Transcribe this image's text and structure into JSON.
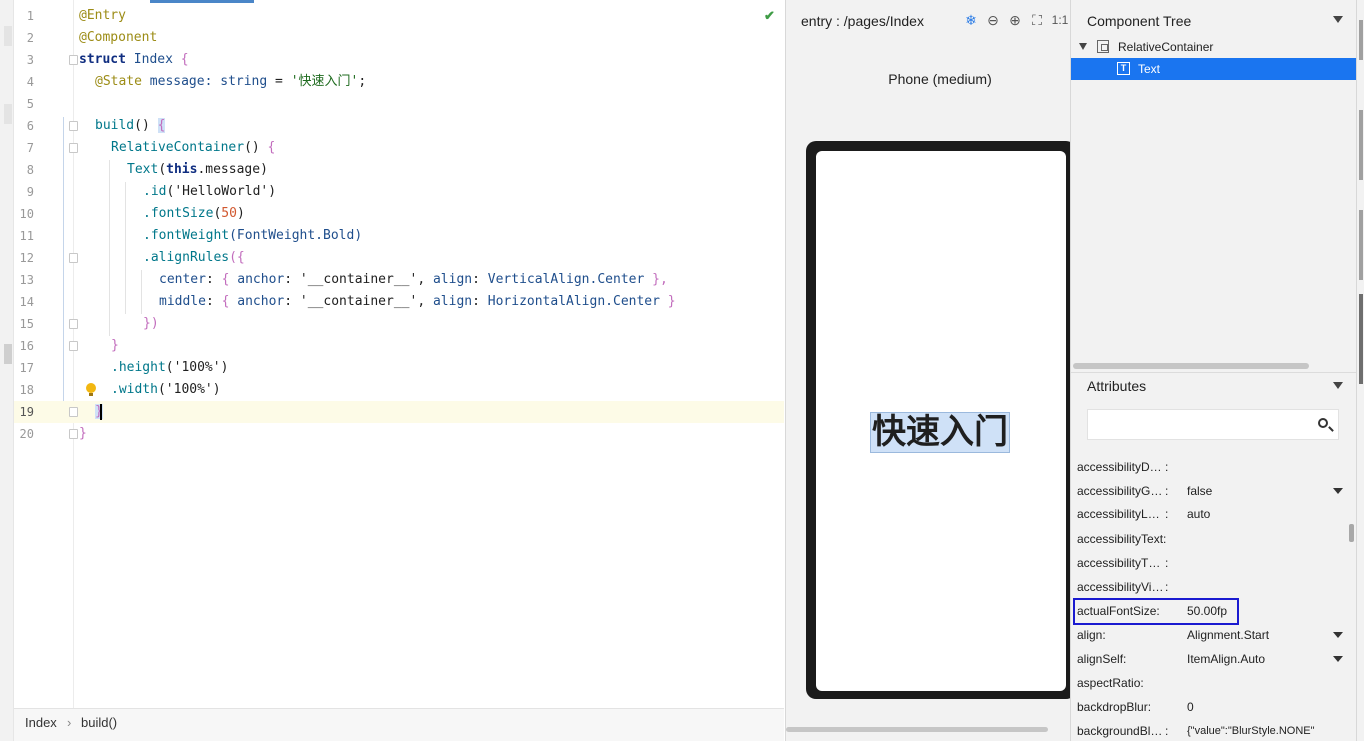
{
  "editor": {
    "lines": [
      {
        "n": "1"
      },
      {
        "n": "2"
      },
      {
        "n": "3"
      },
      {
        "n": "4"
      },
      {
        "n": "5"
      },
      {
        "n": "6"
      },
      {
        "n": "7"
      },
      {
        "n": "8"
      },
      {
        "n": "9"
      },
      {
        "n": "10"
      },
      {
        "n": "11"
      },
      {
        "n": "12"
      },
      {
        "n": "13"
      },
      {
        "n": "14"
      },
      {
        "n": "15"
      },
      {
        "n": "16"
      },
      {
        "n": "17"
      },
      {
        "n": "18"
      },
      {
        "n": "19"
      },
      {
        "n": "20"
      }
    ],
    "code": {
      "l1": "@Entry",
      "l2": "@Component",
      "l3_kw": "struct",
      "l3_name": " Index ",
      "l3_brace": "{",
      "l4_ann": "@State",
      "l4_a": " message: ",
      "l4_type": "string",
      "l4_eq": " = ",
      "l4_str": "'快速入门'",
      "l4_end": ";",
      "l6_fn": "build",
      "l6_paren": "() ",
      "l6_brace": "{",
      "l7_fn": "RelativeContainer",
      "l7_paren": "() ",
      "l7_brace": "{",
      "l8_fn": "Text",
      "l8_open": "(",
      "l8_this": "this",
      "l8_rest": ".message)",
      "l9_fn": ".id",
      "l9_open": "(",
      "l9_str": "'HelloWorld'",
      "l9_close": ")",
      "l10_fn": ".fontSize",
      "l10_open": "(",
      "l10_num": "50",
      "l10_close": ")",
      "l11_fn": ".fontWeight",
      "l11_arg": "(FontWeight.Bold)",
      "l12_fn": ".alignRules",
      "l12_open": "({",
      "l13_key": "center",
      "l13_a": ": ",
      "l13_b1": "{",
      "l13_k2": " anchor",
      "l13_c": ": ",
      "l13_str": "'__container__'",
      "l13_comma": ", ",
      "l13_k3": "align",
      "l13_d": ": ",
      "l13_val": "VerticalAlign.Center",
      "l13_b2": " },",
      "l14_key": "middle",
      "l14_a": ": ",
      "l14_b1": "{",
      "l14_k2": " anchor",
      "l14_c": ": ",
      "l14_str": "'__container__'",
      "l14_comma": ", ",
      "l14_k3": "align",
      "l14_d": ": ",
      "l14_val": "HorizontalAlign.Center",
      "l14_b2": " }",
      "l15": "})",
      "l16": "}",
      "l17_fn": ".height",
      "l17_open": "(",
      "l17_str": "'100%'",
      "l17_close": ")",
      "l18_fn": ".width",
      "l18_open": "(",
      "l18_str": "'100%'",
      "l18_close": ")",
      "l19": "}",
      "l20": "}"
    },
    "status_check": "✔"
  },
  "breadcrumb": {
    "items": [
      "Index",
      "build()"
    ],
    "separator": "›"
  },
  "preview": {
    "path": "entry : /pages/Index",
    "tools": {
      "freeze": "❄",
      "zoom_out": "⊖",
      "zoom_in": "⊕",
      "fit": "⛶",
      "ratio": "1:1"
    },
    "device": "Phone (medium)",
    "rendered_text": "快速入门"
  },
  "component_tree": {
    "title": "Component Tree",
    "nodes": [
      {
        "label": "RelativeContainer"
      },
      {
        "label": "Text"
      }
    ]
  },
  "attributes": {
    "title": "Attributes",
    "search_placeholder": "",
    "rows": [
      {
        "key": "accessibilityD…",
        "value": ""
      },
      {
        "key": "accessibilityG…",
        "value": "false"
      },
      {
        "key": "accessibilityL…",
        "value": "auto"
      },
      {
        "key": "accessibilityText:",
        "value": ""
      },
      {
        "key": "accessibilityT…",
        "value": ""
      },
      {
        "key": "accessibilityVi…",
        "value": ""
      },
      {
        "key": "actualFontSize:",
        "value": "50.00fp"
      },
      {
        "key": "align:",
        "value": "Alignment.Start"
      },
      {
        "key": "alignSelf:",
        "value": "ItemAlign.Auto"
      },
      {
        "key": "aspectRatio:",
        "value": ""
      },
      {
        "key": "backdropBlur:",
        "value": "0"
      },
      {
        "key": "backgroundBl…",
        "value": "{\"value\":\"BlurStyle.NONE\""
      }
    ],
    "colon": ":"
  },
  "colors": {
    "selection": "#1a75f0",
    "highlight_box": "#1a1ad0",
    "current_line": "#fdfbe7"
  }
}
